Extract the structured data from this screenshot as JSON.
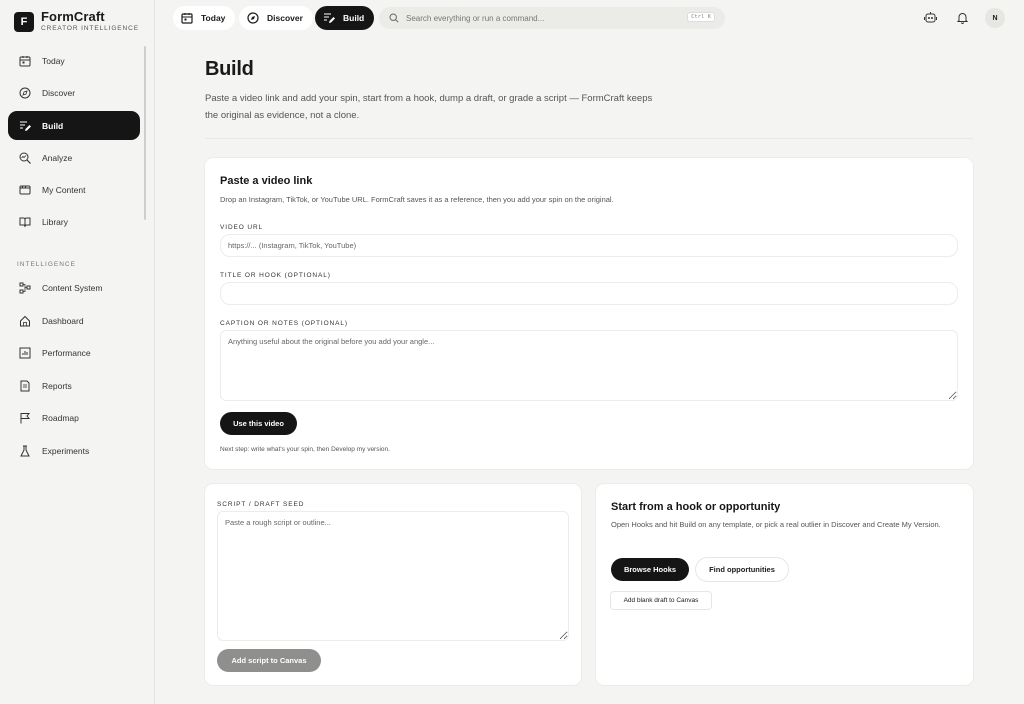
{
  "brand": {
    "name": "FormCraft",
    "tagline": "CREATOR INTELLIGENCE",
    "mark": "F"
  },
  "sidebar": {
    "items": [
      {
        "label": "Today",
        "icon": "calendar-icon"
      },
      {
        "label": "Discover",
        "icon": "compass-icon"
      },
      {
        "label": "Build",
        "icon": "edit-icon"
      },
      {
        "label": "Analyze",
        "icon": "analyze-icon"
      },
      {
        "label": "My Content",
        "icon": "film-icon"
      },
      {
        "label": "Library",
        "icon": "book-icon"
      }
    ],
    "section_label": "INTELLIGENCE",
    "section_items": [
      {
        "label": "Content System",
        "icon": "flow-icon"
      },
      {
        "label": "Dashboard",
        "icon": "home-icon"
      },
      {
        "label": "Performance",
        "icon": "chart-icon"
      },
      {
        "label": "Reports",
        "icon": "report-icon"
      },
      {
        "label": "Roadmap",
        "icon": "flag-icon"
      },
      {
        "label": "Experiments",
        "icon": "flask-icon"
      }
    ]
  },
  "topbar": {
    "tabs": [
      {
        "label": "Today",
        "icon": "calendar-icon"
      },
      {
        "label": "Discover",
        "icon": "compass-icon"
      },
      {
        "label": "Build",
        "icon": "edit-icon"
      }
    ],
    "search_placeholder": "Search everything or run a command...",
    "search_shortcut": "Ctrl K",
    "avatar_initial": "N"
  },
  "page": {
    "title": "Build",
    "description": "Paste a video link and add your spin, start from a hook, dump a draft, or grade a script — FormCraft keeps the original as evidence, not a clone."
  },
  "video_card": {
    "title": "Paste a video link",
    "subtitle": "Drop an Instagram, TikTok, or YouTube URL. FormCraft saves it as a reference, then you add your spin on the original.",
    "url_label": "VIDEO URL",
    "url_placeholder": "https://... (Instagram, TikTok, YouTube)",
    "url_value": "",
    "title_label": "TITLE OR HOOK (OPTIONAL)",
    "title_placeholder": "",
    "title_value": "",
    "caption_label": "CAPTION OR NOTES (OPTIONAL)",
    "caption_placeholder": "Anything useful about the original before you add your angle...",
    "caption_value": "",
    "button": "Use this video",
    "next_step": "Next step: write what's your spin, then Develop my version."
  },
  "script_card": {
    "label": "SCRIPT / DRAFT SEED",
    "placeholder": "Paste a rough script or outline...",
    "value": "",
    "button": "Add script to Canvas"
  },
  "hook_card": {
    "title": "Start from a hook or opportunity",
    "subtitle": "Open Hooks and hit Build on any template, or pick a real outlier in Discover and Create My Version.",
    "browse_button": "Browse Hooks",
    "find_button": "Find opportunities",
    "blank_button": "Add blank draft to Canvas"
  },
  "colors": {
    "accent": "#151515",
    "background": "#f4f4f2",
    "card": "#ffffff"
  }
}
